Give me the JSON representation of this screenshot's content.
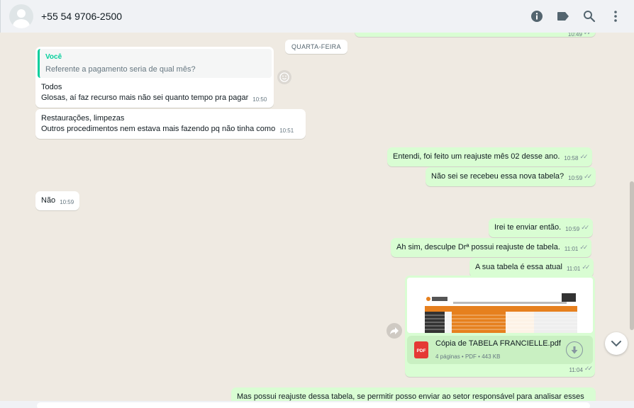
{
  "contact": {
    "name": "+55 54 9706-2500"
  },
  "header_icons": [
    "info-icon",
    "label-icon",
    "search-icon",
    "menu-icon"
  ],
  "day_separator": "QUARTA-FEIRA",
  "messages": [
    {
      "id": "m0",
      "dir": "out",
      "time": "10:49"
    },
    {
      "id": "m1",
      "dir": "in",
      "quote_author": "Você",
      "quote_text": "Referente a pagamento seria de qual mês?",
      "lines": [
        "Todos",
        "Glosas, aí faz recurso mais não sei quanto tempo pra pagar"
      ],
      "time": "10:50"
    },
    {
      "id": "m2",
      "dir": "in",
      "lines": [
        "Restaurações, limpezas",
        "Outros procedimentos nem estava mais fazendo pq não tinha como"
      ],
      "time": "10:51"
    },
    {
      "id": "m3",
      "dir": "out",
      "text": "Entendi, foi feito um reajuste mês 02 desse ano.",
      "time": "10:58"
    },
    {
      "id": "m4",
      "dir": "out",
      "text": "Não sei se recebeu essa nova tabela?",
      "time": "10:59"
    },
    {
      "id": "m5",
      "dir": "in",
      "text": "Não",
      "time": "10:59"
    },
    {
      "id": "m6",
      "dir": "out",
      "text": "Irei te enviar então.",
      "time": "10:59"
    },
    {
      "id": "m7",
      "dir": "out",
      "text": "Ah sim, desculpe Drª possui reajuste de tabela.",
      "time": "11:01"
    },
    {
      "id": "m8",
      "dir": "out",
      "text": "A sua tabela é essa atual",
      "time": "11:01"
    },
    {
      "id": "m9",
      "dir": "out",
      "document": {
        "name": "Cópia de TABELA FRANCIELLE.pdf",
        "details": "4 páginas • PDF • 443 KB",
        "badge": "PDF"
      },
      "time": "11:04"
    },
    {
      "id": "m10",
      "dir": "out",
      "text": "Mas possui reajuste dessa tabela, se permitir posso enviar ao setor responsável para analisar esses"
    }
  ],
  "colors": {
    "incoming": "#ffffff",
    "outgoing": "#d9fdd3",
    "background": "#efeae2",
    "quote_accent": "#06cf9c",
    "pdf_red": "#e53935"
  }
}
